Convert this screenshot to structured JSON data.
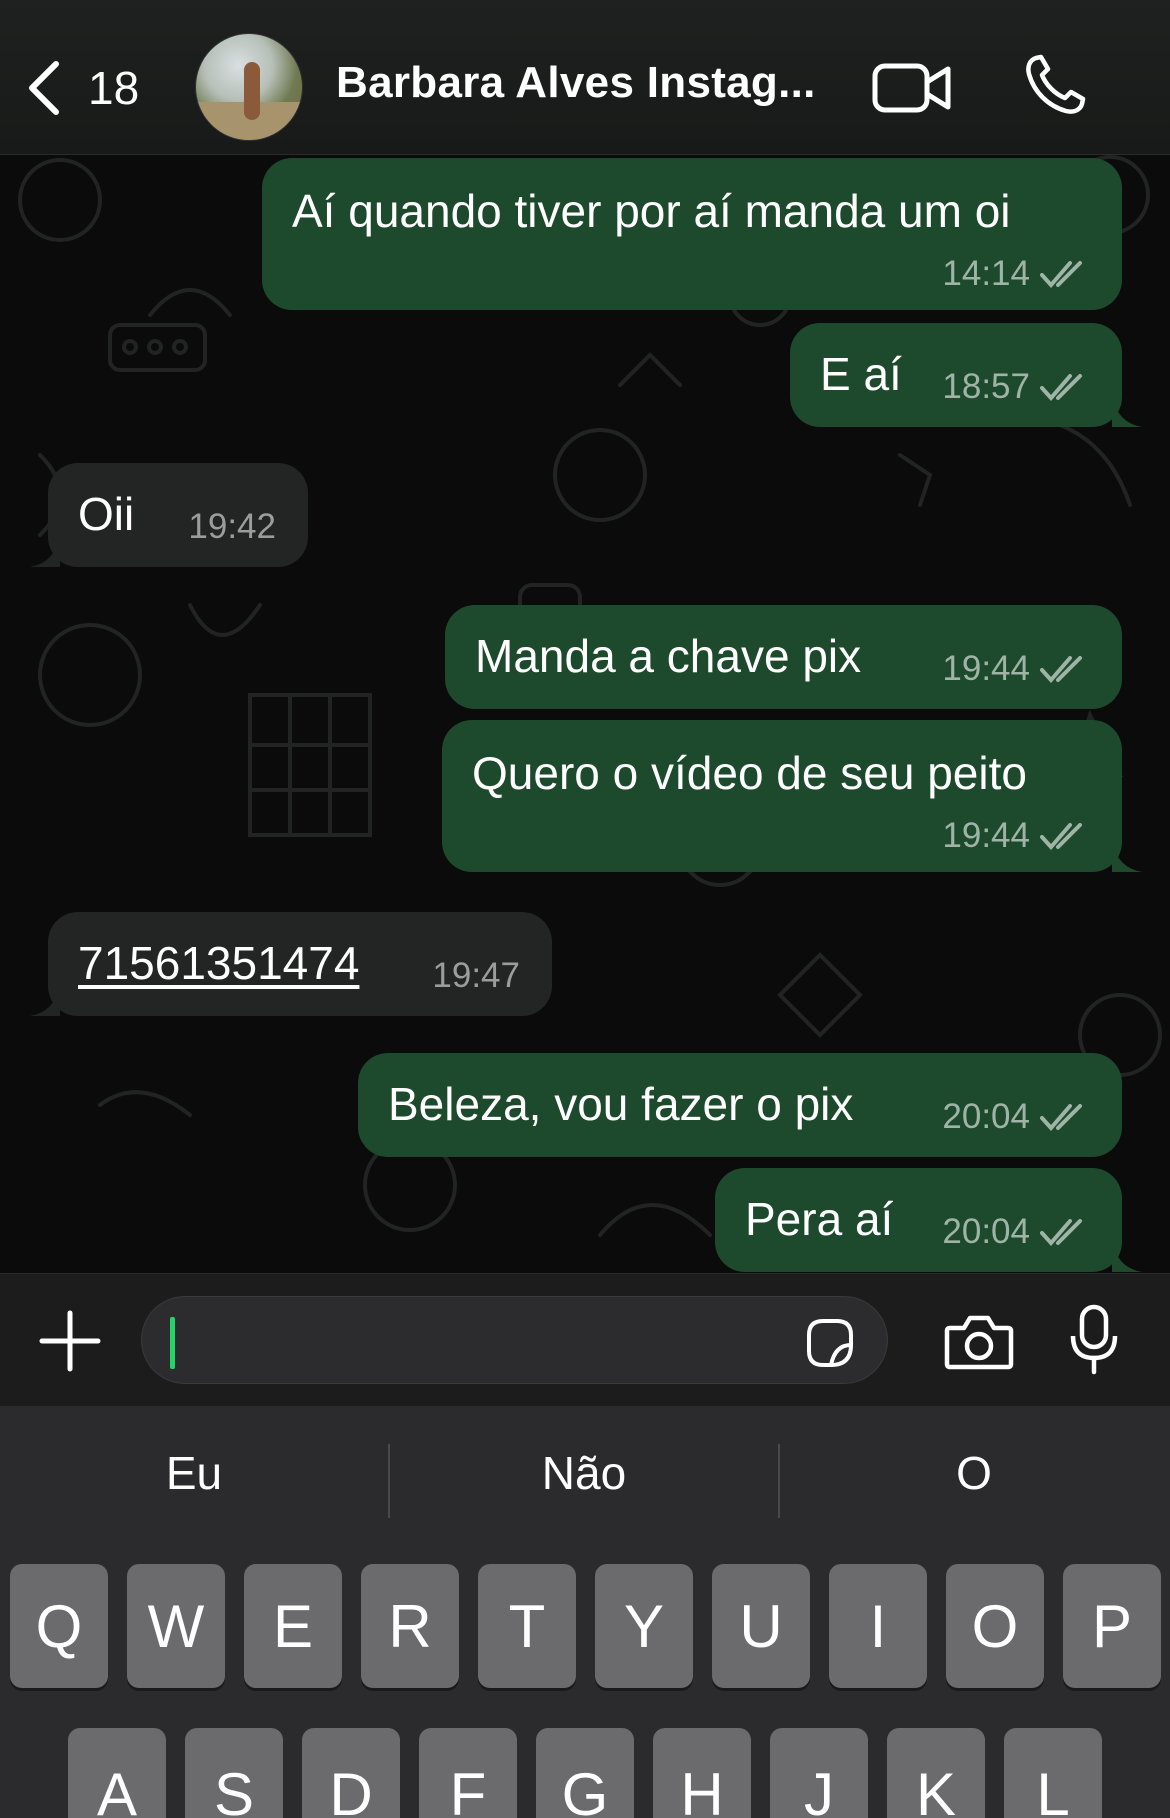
{
  "header": {
    "back_count": "18",
    "contact_name": "Barbara Alves Instag...",
    "icons": [
      "back-chevron-icon",
      "avatar",
      "video-call-icon",
      "phone-icon"
    ]
  },
  "messages": [
    {
      "dir": "out",
      "text": "Aí quando tiver por aí manda um oi",
      "time": "14:14",
      "status": "read"
    },
    {
      "dir": "out",
      "text": "E aí",
      "time": "18:57",
      "status": "read"
    },
    {
      "dir": "in",
      "text": "Oii",
      "time": "19:42"
    },
    {
      "dir": "out",
      "text": "Manda a chave pix",
      "time": "19:44",
      "status": "read"
    },
    {
      "dir": "out",
      "text": "Quero o vídeo de seu peito",
      "time": "19:44",
      "status": "read"
    },
    {
      "dir": "in",
      "text": "71561351474",
      "time": "19:47",
      "is_link": true
    },
    {
      "dir": "out",
      "text": "Beleza, vou fazer o pix",
      "time": "20:04",
      "status": "read"
    },
    {
      "dir": "out",
      "text": "Pera aí",
      "time": "20:04",
      "status": "read"
    }
  ],
  "input": {
    "value": "",
    "icons": [
      "plus-icon",
      "sticker-icon",
      "camera-icon",
      "microphone-icon"
    ]
  },
  "keyboard": {
    "suggestions": [
      "Eu",
      "Não",
      "O"
    ],
    "row1": [
      "Q",
      "W",
      "E",
      "R",
      "T",
      "Y",
      "U",
      "I",
      "O",
      "P"
    ],
    "row2": [
      "A",
      "S",
      "D",
      "F",
      "G",
      "H",
      "J",
      "K",
      "L"
    ]
  },
  "colors": {
    "outgoing_bubble": "#1d4a2d",
    "incoming_bubble": "#232424",
    "link": "#5fcf74",
    "caret": "#25d366",
    "read_ticks": "#9fb4a6"
  }
}
